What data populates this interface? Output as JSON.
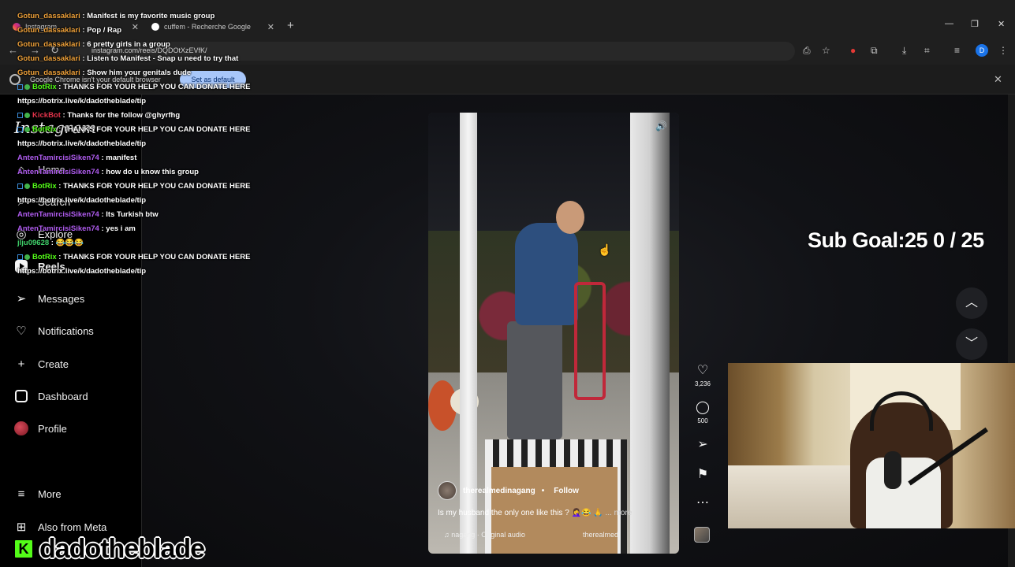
{
  "browser": {
    "tabs": [
      {
        "label": "Instagram",
        "active": true
      },
      {
        "label": "cuffem - Recherche Google",
        "active": false
      }
    ],
    "url": "instagram.com/reels/DQDOtXzEVfK/",
    "profile_initial": "D",
    "infobar": {
      "message": "Google Chrome isn't your default browser",
      "button": "Set as default"
    }
  },
  "sidebar": {
    "logo": "Instagram",
    "items": [
      {
        "label": "Home",
        "icon": "home-icon"
      },
      {
        "label": "Search",
        "icon": "search-icon"
      },
      {
        "label": "Explore",
        "icon": "compass-icon"
      },
      {
        "label": "Reels",
        "icon": "reels-icon"
      },
      {
        "label": "Messages",
        "icon": "send-icon"
      },
      {
        "label": "Notifications",
        "icon": "heart-icon"
      },
      {
        "label": "Create",
        "icon": "plus-icon"
      },
      {
        "label": "Dashboard",
        "icon": "chart-icon"
      },
      {
        "label": "Profile",
        "icon": "avatar-icon"
      },
      {
        "label": "More",
        "icon": "menu-icon"
      },
      {
        "label": "Also from Meta",
        "icon": "meta-icon"
      }
    ]
  },
  "reel": {
    "author": "therealmedinagang",
    "follow": "Follow",
    "caption": "Is my husband the only one like this ? 🤦‍♀️😂 🙏",
    "more": "... more",
    "audio": "nagang · Original audio",
    "audio_tail": "therealmedi",
    "likes": "3,236",
    "comments": "500"
  },
  "chat": [
    {
      "user": "Gotun_dassaklari",
      "color": "#f0a23a",
      "bot": false,
      "text": "Manifest is my favorite music group"
    },
    {
      "user": "Gotun_dassaklari",
      "color": "#f0a23a",
      "bot": false,
      "text": "Pop / Rap"
    },
    {
      "user": "Gotun_dassaklari",
      "color": "#f0a23a",
      "bot": false,
      "text": "6 pretty girls in a group"
    },
    {
      "user": "Gotun_dassaklari",
      "color": "#f0a23a",
      "bot": false,
      "text": "Listen to Manifest - Snap u need to try that"
    },
    {
      "user": "Gotun_dassaklari",
      "color": "#f0a23a",
      "bot": false,
      "text": "Show him your genitals dude"
    },
    {
      "user": "BotRix",
      "color": "#53fc18",
      "bot": true,
      "text": "THANKS FOR YOUR HELP YOU CAN DONATE HERE"
    },
    {
      "user": "",
      "color": "#ffffff",
      "bot": false,
      "text": "https://botrix.live/k/dadotheblade/tip"
    },
    {
      "user": "KickBot",
      "color": "#e0334a",
      "bot": true,
      "text": "Thanks for the follow @ghyrfhg"
    },
    {
      "user": "BotRix",
      "color": "#53fc18",
      "bot": true,
      "text": "THANKS FOR YOUR HELP YOU CAN DONATE HERE"
    },
    {
      "user": "",
      "color": "#ffffff",
      "bot": false,
      "text": "https://botrix.live/k/dadotheblade/tip"
    },
    {
      "user": "AntenTamircisiSiken74",
      "color": "#b05cf0",
      "bot": false,
      "text": "manifest"
    },
    {
      "user": "AntenTamircisiSiken74",
      "color": "#b05cf0",
      "bot": false,
      "text": "how do u know this group"
    },
    {
      "user": "BotRix",
      "color": "#53fc18",
      "bot": true,
      "text": "THANKS FOR YOUR HELP YOU CAN DONATE HERE"
    },
    {
      "user": "",
      "color": "#ffffff",
      "bot": false,
      "text": "https://botrix.live/k/dadotheblade/tip"
    },
    {
      "user": "AntenTamircisiSiken74",
      "color": "#b05cf0",
      "bot": false,
      "text": "Its Turkish btw"
    },
    {
      "user": "AntenTamircisiSiken74",
      "color": "#b05cf0",
      "bot": false,
      "text": "yes i am"
    },
    {
      "user": "jlju09628",
      "color": "#3fd06a",
      "bot": false,
      "text": "😂😂😂"
    },
    {
      "user": "BotRix",
      "color": "#53fc18",
      "bot": true,
      "text": "THANKS FOR YOUR HELP YOU CAN DONATE HERE"
    },
    {
      "user": "",
      "color": "#ffffff",
      "bot": false,
      "text": "https://botrix.live/k/dadotheblade/tip"
    }
  ],
  "overlay": {
    "sub_goal": "Sub Goal:25  0 / 25",
    "brand_logo": "K",
    "brand_name": "dadotheblade"
  },
  "colors": {
    "kick_green": "#53fc18",
    "chrome_bg": "#1f1f1f",
    "instagram_bg": "#000000"
  }
}
